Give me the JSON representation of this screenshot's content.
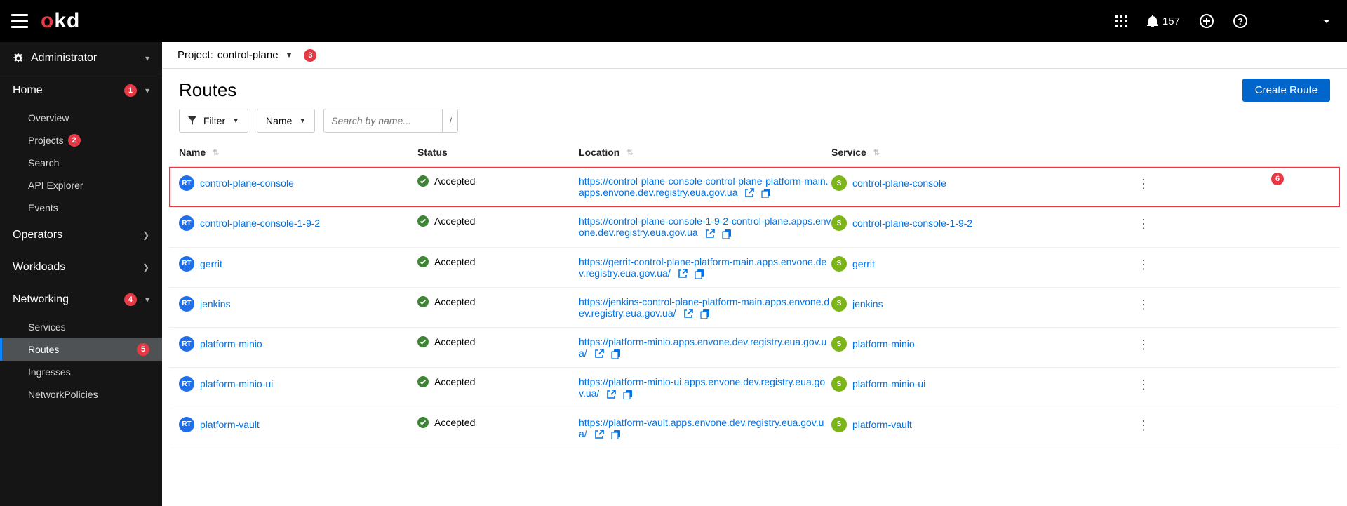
{
  "masthead": {
    "brand_o": "o",
    "brand_kd": "kd",
    "notif_count": "157"
  },
  "sidebar": {
    "perspective": "Administrator",
    "sections": {
      "home": {
        "label": "Home",
        "callout": "1",
        "items": [
          "Overview",
          "Projects",
          "Search",
          "API Explorer",
          "Events"
        ],
        "projects_callout": "2"
      },
      "operators": {
        "label": "Operators"
      },
      "workloads": {
        "label": "Workloads"
      },
      "networking": {
        "label": "Networking",
        "callout": "4",
        "items": [
          "Services",
          "Routes",
          "Ingresses",
          "NetworkPolicies"
        ],
        "routes_callout": "5"
      }
    }
  },
  "project_bar": {
    "prefix": "Project:",
    "value": "control-plane",
    "callout": "3"
  },
  "page": {
    "title": "Routes",
    "create_btn": "Create Route"
  },
  "filter_bar": {
    "filter": "Filter",
    "name": "Name",
    "search_placeholder": "Search by name...",
    "slash": "/"
  },
  "table": {
    "headers": {
      "name": "Name",
      "status": "Status",
      "location": "Location",
      "service": "Service"
    },
    "status_accepted": "Accepted",
    "rows": [
      {
        "name": "control-plane-console",
        "location": "https://control-plane-console-control-plane-platform-main.apps.envone.dev.registry.eua.gov.ua",
        "service": "control-plane-console",
        "highlight": true
      },
      {
        "name": "control-plane-console-1-9-2",
        "location": "https://control-plane-console-1-9-2-control-plane.apps.envone.dev.registry.eua.gov.ua",
        "service": "control-plane-console-1-9-2"
      },
      {
        "name": "gerrit",
        "location": "https://gerrit-control-plane-platform-main.apps.envone.dev.registry.eua.gov.ua/",
        "service": "gerrit"
      },
      {
        "name": "jenkins",
        "location": "https://jenkins-control-plane-platform-main.apps.envone.dev.registry.eua.gov.ua/",
        "service": "jenkins"
      },
      {
        "name": "platform-minio",
        "location": "https://platform-minio.apps.envone.dev.registry.eua.gov.ua/",
        "service": "platform-minio"
      },
      {
        "name": "platform-minio-ui",
        "location": "https://platform-minio-ui.apps.envone.dev.registry.eua.gov.ua/",
        "service": "platform-minio-ui"
      },
      {
        "name": "platform-vault",
        "location": "https://platform-vault.apps.envone.dev.registry.eua.gov.ua/",
        "service": "platform-vault"
      }
    ],
    "row_callout": "6"
  }
}
